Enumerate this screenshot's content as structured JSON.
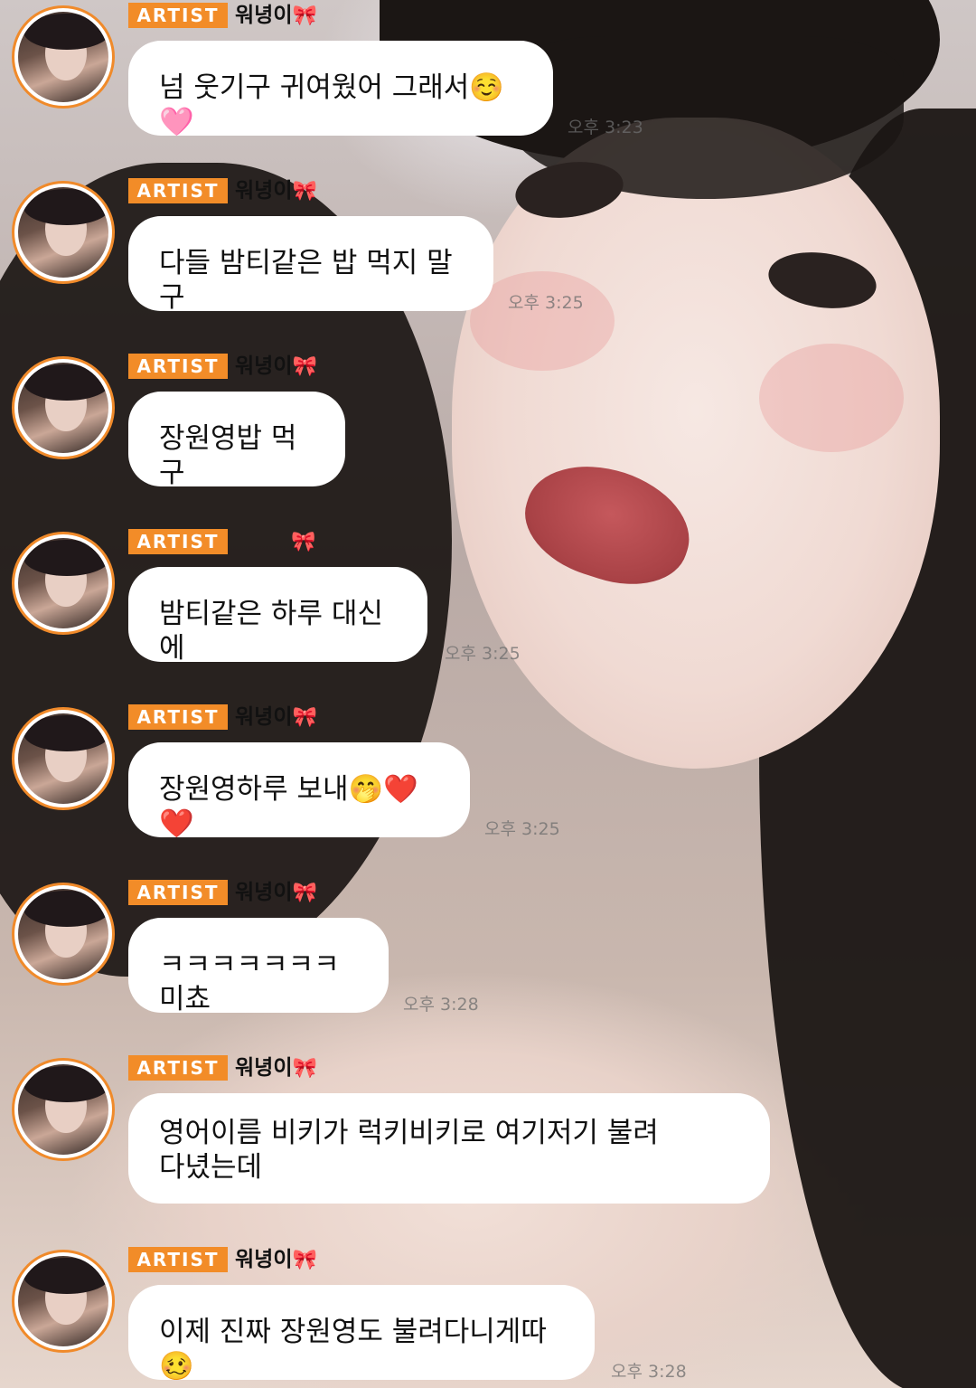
{
  "badge_label": "ARTIST",
  "sender_name": "워녕이",
  "ribbon_icon": "🎀",
  "accent_color": "#f28c28",
  "messages": [
    {
      "text": "넘 웃기구 귀여웠어 그래서☺️🩷",
      "time": "오후 3:23",
      "name_visible": true
    },
    {
      "text": "다들 밤티같은 밥 먹지 말구",
      "time": "오후 3:25",
      "name_visible": true
    },
    {
      "text": "장원영밥 먹구",
      "time": "",
      "name_visible": true
    },
    {
      "text": "밤티같은 하루 대신에",
      "time": "오후 3:25",
      "name_visible": false
    },
    {
      "text": "장원영하루 보내🤭❤️❤️",
      "time": "오후 3:25",
      "name_visible": true
    },
    {
      "text": "ㅋㅋㅋㅋㅋㅋㅋ미쵸",
      "time": "오후 3:28",
      "name_visible": true
    },
    {
      "text": "영어이름 비키가 럭키비키로 여기저기 불려\n다녔는데",
      "time": "",
      "name_visible": true
    },
    {
      "text": "이제 진짜 장원영도 불려다니게따🥴",
      "time": "오후 3:28",
      "name_visible": true
    }
  ]
}
